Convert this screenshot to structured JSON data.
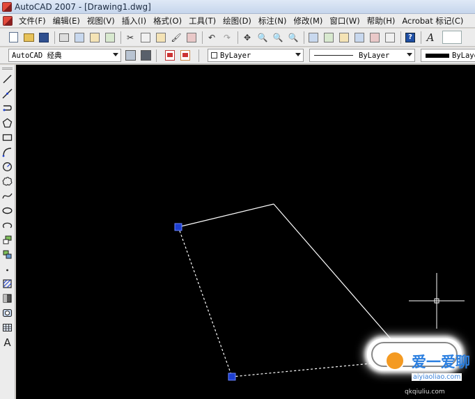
{
  "window": {
    "title": "AutoCAD 2007 - [Drawing1.dwg]"
  },
  "menu": {
    "items": [
      {
        "label": "文件(F)"
      },
      {
        "label": "编辑(E)"
      },
      {
        "label": "视图(V)"
      },
      {
        "label": "插入(I)"
      },
      {
        "label": "格式(O)"
      },
      {
        "label": "工具(T)"
      },
      {
        "label": "绘图(D)"
      },
      {
        "label": "标注(N)"
      },
      {
        "label": "修改(M)"
      },
      {
        "label": "窗口(W)"
      },
      {
        "label": "帮助(H)"
      },
      {
        "label": "Acrobat 标记(C)"
      }
    ]
  },
  "properties_toolbar": {
    "workspace": "AutoCAD 经典",
    "color": "ByLayer",
    "linetype": "ByLayer",
    "lineweight": "ByLayer"
  },
  "draw_toolbar": {
    "text_tool_glyph": "A"
  },
  "watermark": {
    "brand": "爱一爱聊",
    "domain": "aiyiaoliao.com",
    "domain2": "qkqiuliu.com"
  },
  "colors": {
    "canvas_background": "#000000",
    "geometry_line": "#ffffff",
    "grip": "#1d3fd1",
    "chrome": "#ececec"
  }
}
